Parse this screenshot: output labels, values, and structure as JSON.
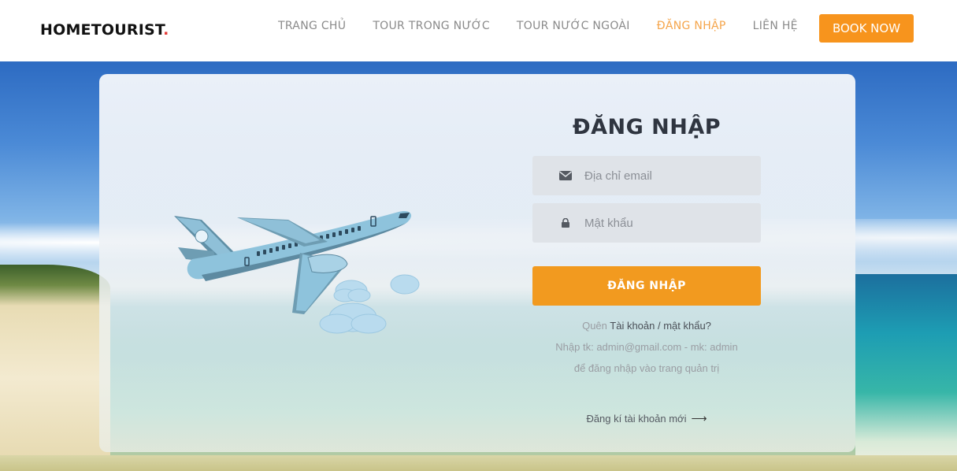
{
  "header": {
    "logo_text": "HOMETOURIST",
    "logo_dot": ".",
    "nav": [
      {
        "label": "TRANG CHỦ",
        "active": false
      },
      {
        "label": "TOUR TRONG NƯỚC",
        "active": false
      },
      {
        "label": "TOUR NƯỚC NGOÀI",
        "active": false
      },
      {
        "label": "ĐĂNG NHẬP",
        "active": true
      },
      {
        "label": "LIÊN HỆ",
        "active": false
      }
    ],
    "book_now": "BOOK NOW"
  },
  "login": {
    "title": "ĐĂNG NHẬP",
    "email_placeholder": "Địa chỉ email",
    "email_icon": "envelope-icon",
    "password_placeholder": "Mật khẩu",
    "password_icon": "lock-icon",
    "submit_label": "ĐĂNG NHẬP",
    "forgot_prefix": "Quên",
    "forgot_link": "Tài khoản / mật khẩu?",
    "info_line1": "Nhập tk: admin@gmail.com - mk: admin",
    "info_line2": "để đăng nhập vào trang quản trị",
    "register_label": "Đăng kí tài khoản mới",
    "register_arrow": "⟶"
  },
  "colors": {
    "accent": "#f7941d",
    "nav_active": "#f5a54b",
    "logo_dot": "#e53935"
  }
}
